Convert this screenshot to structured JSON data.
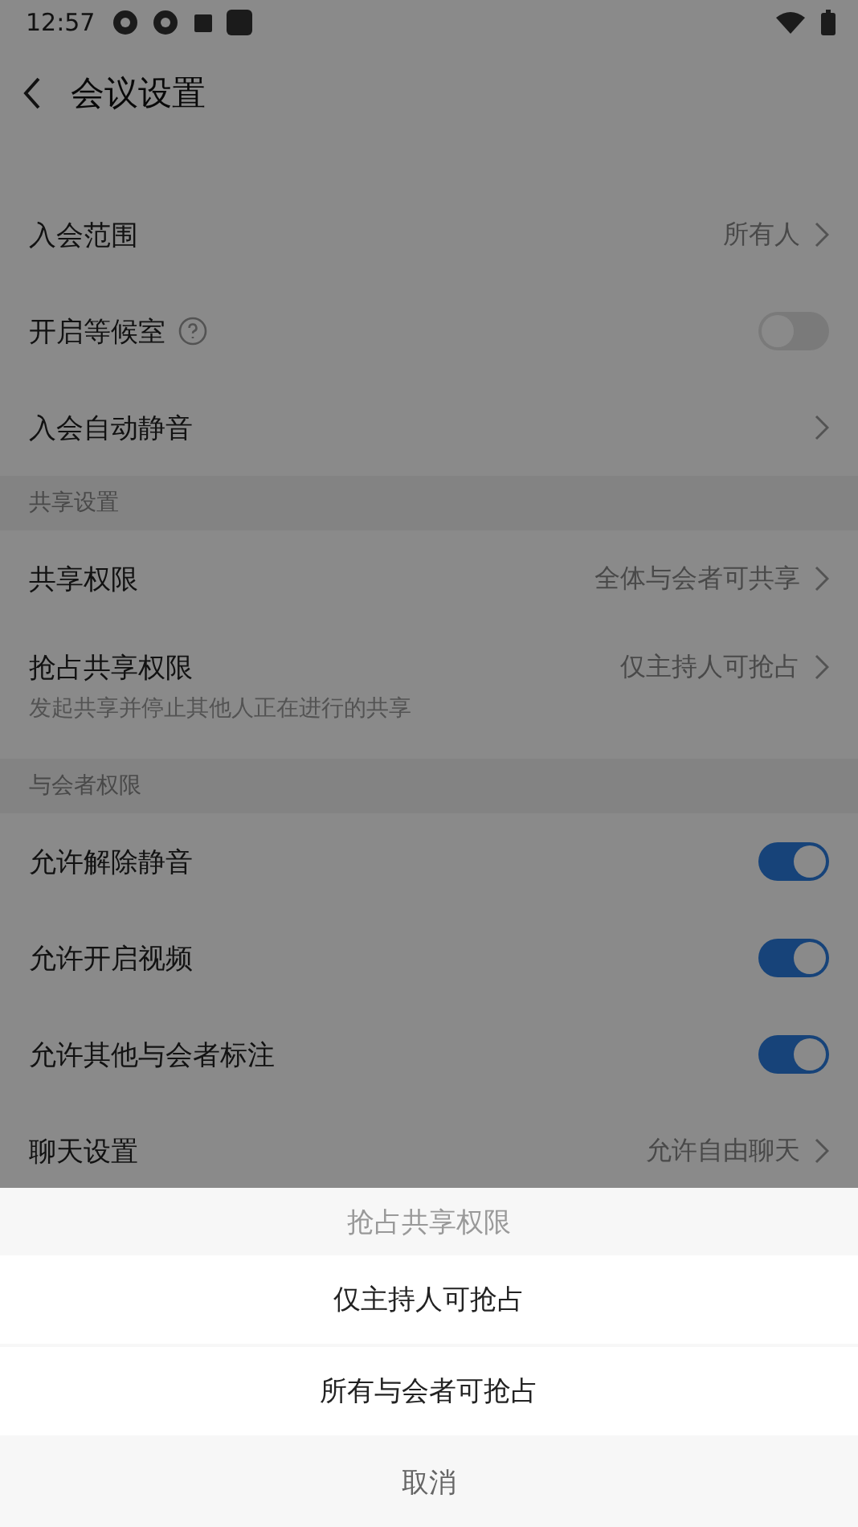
{
  "status_bar": {
    "time": "12:57"
  },
  "header": {
    "title": "会议设置"
  },
  "sections": [
    {
      "rows": [
        {
          "kind": "value",
          "label": "入会范围",
          "value": "所有人"
        },
        {
          "kind": "toggle",
          "label": "开启等候室",
          "help": true,
          "on": false
        },
        {
          "kind": "link",
          "label": "入会自动静音"
        }
      ]
    },
    {
      "title": "共享设置",
      "rows": [
        {
          "kind": "value",
          "label": "共享权限",
          "value": "全体与会者可共享"
        },
        {
          "kind": "value",
          "label": "抢占共享权限",
          "value": "仅主持人可抢占",
          "note": "发起共享并停止其他人正在进行的共享"
        }
      ]
    },
    {
      "title": "与会者权限",
      "rows": [
        {
          "kind": "toggle",
          "label": "允许解除静音",
          "on": true
        },
        {
          "kind": "toggle",
          "label": "允许开启视频",
          "on": true
        },
        {
          "kind": "toggle",
          "label": "允许其他与会者标注",
          "on": true
        },
        {
          "kind": "value",
          "label": "聊天设置",
          "value": "允许自由聊天"
        }
      ]
    }
  ],
  "sheet": {
    "title": "抢占共享权限",
    "options": [
      "仅主持人可抢占",
      "所有与会者可抢占"
    ],
    "cancel": "取消"
  }
}
